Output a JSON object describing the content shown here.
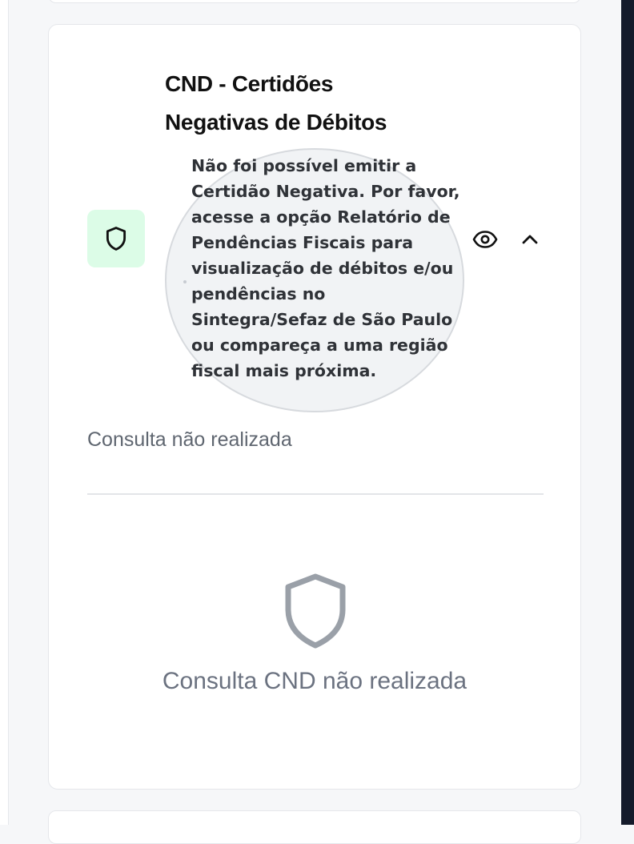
{
  "card": {
    "title": "CND - Certidões Negativas de Débitos",
    "tooltip": "Não foi possível emitir a Certidão Negativa. Por favor, acesse a opção Relatório de Pendências Fiscais para visualização de débitos e/ou pendências no Sintegra/Sefaz de São Paulo ou compareça a uma região fiscal mais próxima.",
    "status": "Consulta não realizada",
    "empty_state": "Consulta CND não realizada"
  },
  "icons": {
    "badge": "shield-icon",
    "view": "eye-icon",
    "collapse": "chevron-up-icon",
    "empty": "shield-icon"
  },
  "colors": {
    "badge_bg": "#dcfce7",
    "title": "#111111",
    "muted": "#6b7280",
    "sidebar": "#141b2b"
  }
}
